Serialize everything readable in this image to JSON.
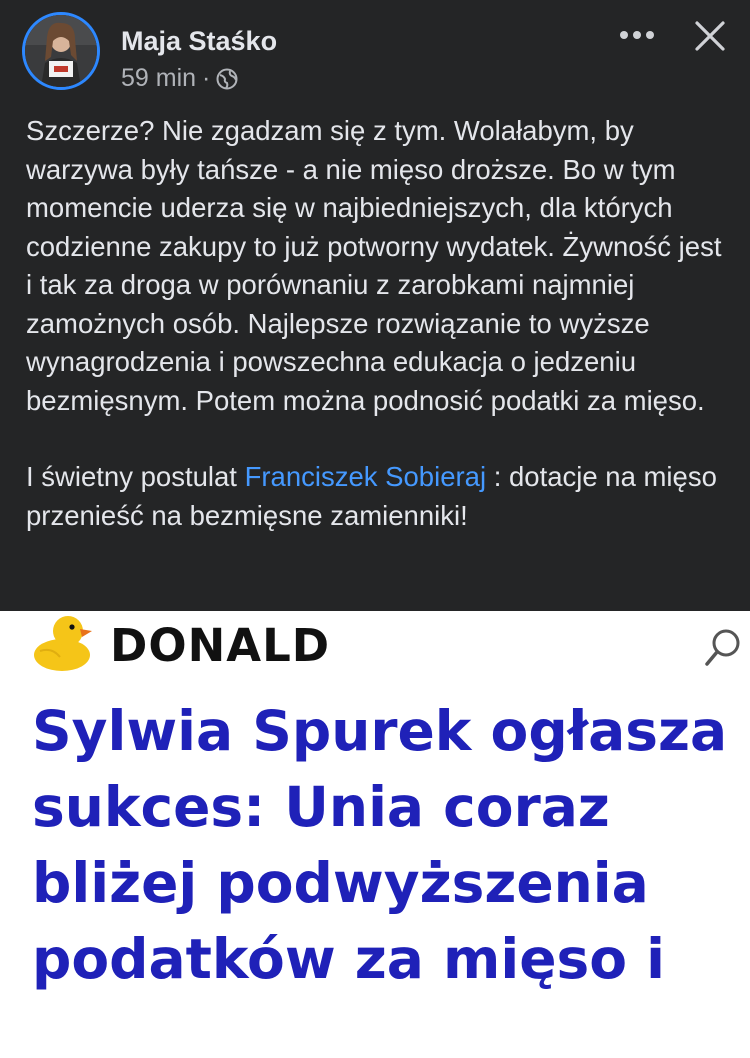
{
  "post": {
    "author": "Maja Staśko",
    "time": "59 min",
    "dot": "·",
    "audience_icon": "globe-icon",
    "paragraph1": "Szczerze? Nie zgadzam się z tym. Wolałabym, by warzywa były tańsze - a nie mięso droższe. Bo w tym momencie uderza się w najbiedniejszych, dla których codzienne zakupy to już potworny wydatek. Żywność jest i tak za droga w porównaniu z zarobkami najmniej zamożnych osób. Najlepsze rozwiązanie to wyższe wynagrodzenia i powszechna edukacja o jedzeniu bezmięsnym. Potem można podnosić podatki za mięso.",
    "paragraph2_before": "I świetny postulat ",
    "mention": "Franciszek Sobieraj",
    "paragraph2_after": " : dotacje na mięso przenieść na bezmięsne zamienniki!"
  },
  "shared": {
    "logo_text": "DONALD",
    "headline": "Sylwia Spurek ogłasza sukces: Unia coraz bliżej podwyższenia podatków za mięso i"
  },
  "colors": {
    "background": "#242526",
    "text": "#e4e6eb",
    "secondary": "#b0b3b8",
    "mention": "#4599ff",
    "headline": "#1f21b8",
    "avatar_ring": "#2d88ff"
  },
  "icons": [
    "more-options-icon",
    "close-icon",
    "globe-icon",
    "duck-logo-icon",
    "search-icon"
  ]
}
